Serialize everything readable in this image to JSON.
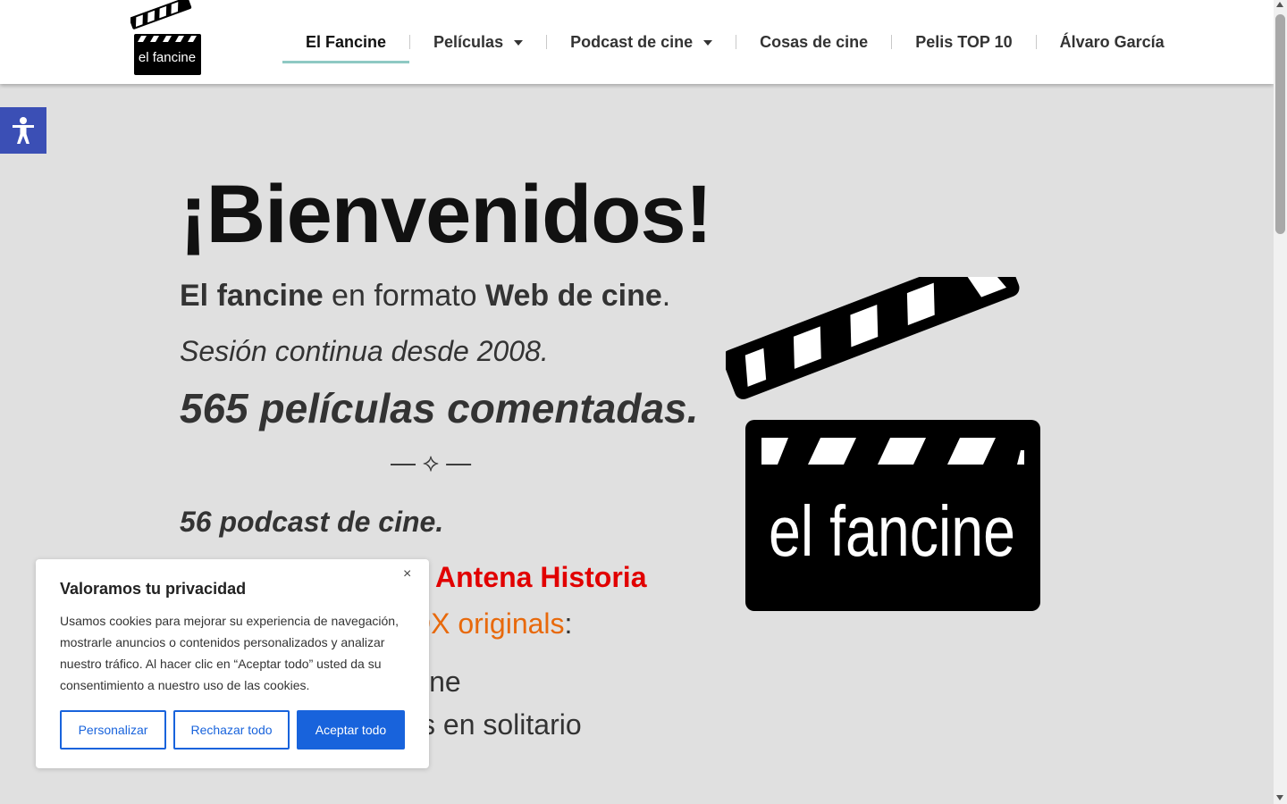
{
  "header": {
    "logo_text": "el fancine",
    "nav": [
      {
        "label": "El Fancine",
        "active": true,
        "has_dropdown": false
      },
      {
        "label": "Películas",
        "active": false,
        "has_dropdown": true
      },
      {
        "label": "Podcast de cine",
        "active": false,
        "has_dropdown": true
      },
      {
        "label": "Cosas de cine",
        "active": false,
        "has_dropdown": false
      },
      {
        "label": "Pelis TOP 10",
        "active": false,
        "has_dropdown": false
      },
      {
        "label": "Álvaro García",
        "active": false,
        "has_dropdown": false
      }
    ]
  },
  "main": {
    "title": "¡Bienvenidos!",
    "line1_part1": "El fancine",
    "line1_part2": " en formato ",
    "line1_part3": "Web de cine",
    "line1_part4": ".",
    "line2": "Sesión continua desde 2008.",
    "line3": "565 películas comentadas.",
    "divider": "— ⟡ —",
    "line4": "56 podcast de cine.",
    "line5": "Antena Historia",
    "line6_prefix": "DX originals",
    "line6_suffix": ":",
    "line7": "ine",
    "line8": "s en solitario",
    "big_logo_text": "el fancine"
  },
  "cookie_banner": {
    "title": "Valoramos tu privacidad",
    "close_symbol": "×",
    "text": "Usamos cookies para mejorar su experiencia de navegación, mostrarle anuncios o contenidos personalizados y analizar nuestro tráfico. Al hacer clic en “Aceptar todo” usted da su consentimiento a nuestro uso de las cookies.",
    "customize_label": "Personalizar",
    "reject_label": "Rechazar todo",
    "accept_label": "Aceptar todo"
  },
  "colors": {
    "background": "#e0e0e0",
    "active_underline": "#8ec9c3",
    "accessibility": "#3b4fb5",
    "cookie_primary": "#1863dc",
    "red_text": "#e10000",
    "orange_text": "#e8690b"
  },
  "icons": {
    "accessibility": "accessibility-person-icon",
    "logo": "clapperboard-icon"
  }
}
